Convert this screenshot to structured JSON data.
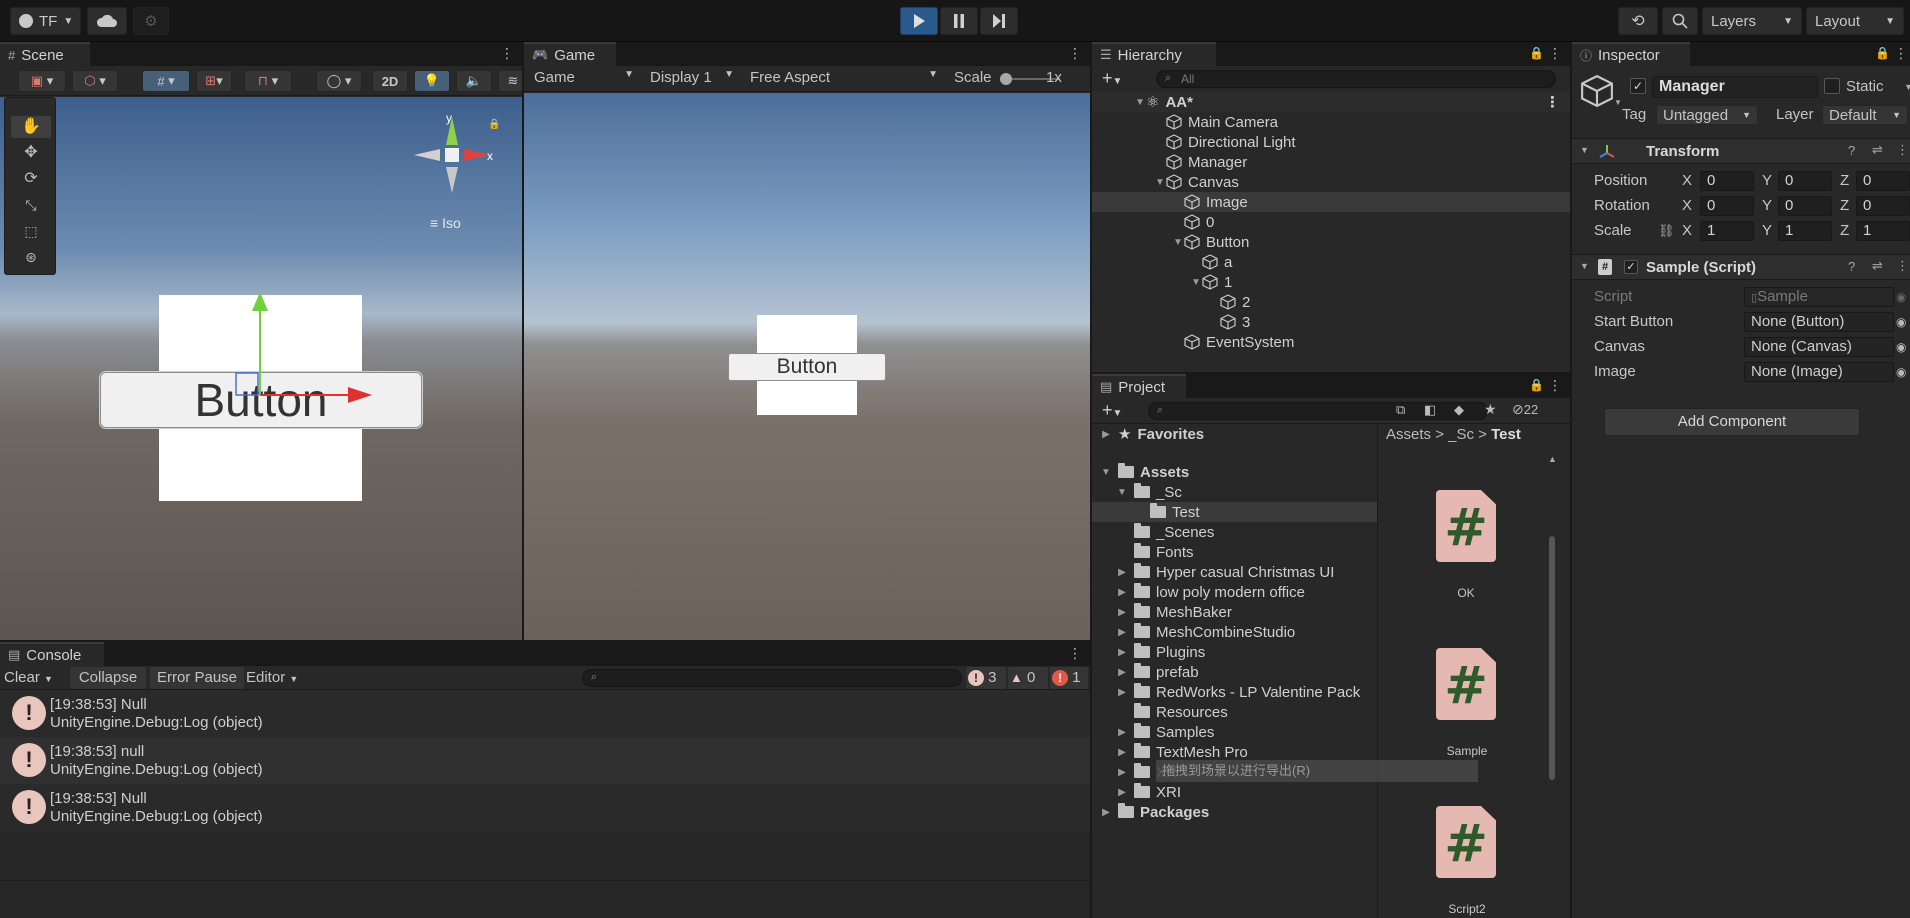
{
  "topbar": {
    "account": "TF",
    "layers_label": "Layers",
    "layout_label": "Layout"
  },
  "scene": {
    "tab": "Scene",
    "mode_2d": "2D",
    "gizmo_y": "y",
    "gizmo_x": "x",
    "iso_label": "Iso",
    "button_text": "Button"
  },
  "game": {
    "tab": "Game",
    "game_dropdown": "Game",
    "display_dropdown": "Display 1",
    "aspect_dropdown": "Free Aspect",
    "scale_label": "Scale",
    "scale_value": "1x",
    "button_text": "Button"
  },
  "hierarchy": {
    "tab": "Hierarchy",
    "search_placeholder": "All",
    "items": [
      {
        "label": "AA*"
      },
      {
        "label": "Main Camera"
      },
      {
        "label": "Directional Light"
      },
      {
        "label": "Manager"
      },
      {
        "label": "Canvas"
      },
      {
        "label": "Image"
      },
      {
        "label": "0"
      },
      {
        "label": "Button"
      },
      {
        "label": "a"
      },
      {
        "label": "1"
      },
      {
        "label": "2"
      },
      {
        "label": "3"
      },
      {
        "label": "EventSystem"
      }
    ]
  },
  "project": {
    "tab": "Project",
    "hidden_count": "22",
    "favorites": "Favorites",
    "assets": "Assets",
    "packages": "Packages",
    "tree": [
      {
        "label": "_Sc"
      },
      {
        "label": "Test"
      },
      {
        "label": "_Scenes"
      },
      {
        "label": "Fonts"
      },
      {
        "label": "Hyper casual Christmas UI"
      },
      {
        "label": "low poly modern office"
      },
      {
        "label": "MeshBaker"
      },
      {
        "label": "MeshCombineStudio"
      },
      {
        "label": "Plugins"
      },
      {
        "label": "prefab"
      },
      {
        "label": "RedWorks - LP Valentine Pack"
      },
      {
        "label": "Resources"
      },
      {
        "label": "Samples"
      },
      {
        "label": "TextMesh Pro"
      },
      {
        "label": "XR"
      },
      {
        "label": "XRI"
      }
    ],
    "breadcrumb": [
      "Assets",
      "_Sc",
      "Test"
    ],
    "files": [
      {
        "label": "OK"
      },
      {
        "label": "Sample"
      },
      {
        "label": "Script2"
      }
    ],
    "tooltip": "拖拽到场景以进行导出(R)"
  },
  "inspector": {
    "tab": "Inspector",
    "object_name": "Manager",
    "static_label": "Static",
    "tag_label": "Tag",
    "tag_value": "Untagged",
    "layer_label": "Layer",
    "layer_value": "Default",
    "transform_title": "Transform",
    "position_label": "Position",
    "rotation_label": "Rotation",
    "scale_label": "Scale",
    "x": "X",
    "y": "Y",
    "z": "Z",
    "position": [
      "0",
      "0",
      "0"
    ],
    "rotation": [
      "0",
      "0",
      "0"
    ],
    "scale": [
      "1",
      "1",
      "1"
    ],
    "script_title": "Sample (Script)",
    "script_label": "Script",
    "script_value": "Sample",
    "fields": [
      {
        "label": "Start Button",
        "value": "None (Button)"
      },
      {
        "label": "Canvas",
        "value": "None (Canvas)"
      },
      {
        "label": "Image",
        "value": "None (Image)"
      }
    ],
    "add_component": "Add Component"
  },
  "console": {
    "tab": "Console",
    "clear": "Clear",
    "collapse": "Collapse",
    "error_pause": "Error Pause",
    "editor": "Editor",
    "warn_count": "3",
    "info_count": "0",
    "error_count": "1",
    "entries": [
      {
        "time": "[19:38:53] Null",
        "detail": "UnityEngine.Debug:Log (object)"
      },
      {
        "time": "[19:38:53] null",
        "detail": "UnityEngine.Debug:Log (object)"
      },
      {
        "time": "[19:38:53] Null",
        "detail": "UnityEngine.Debug:Log (object)"
      }
    ]
  },
  "colors": {
    "accent_play": "#2a5a8c",
    "selected_row": "#3a3a3a",
    "script_icon": "#e5b9b1"
  }
}
